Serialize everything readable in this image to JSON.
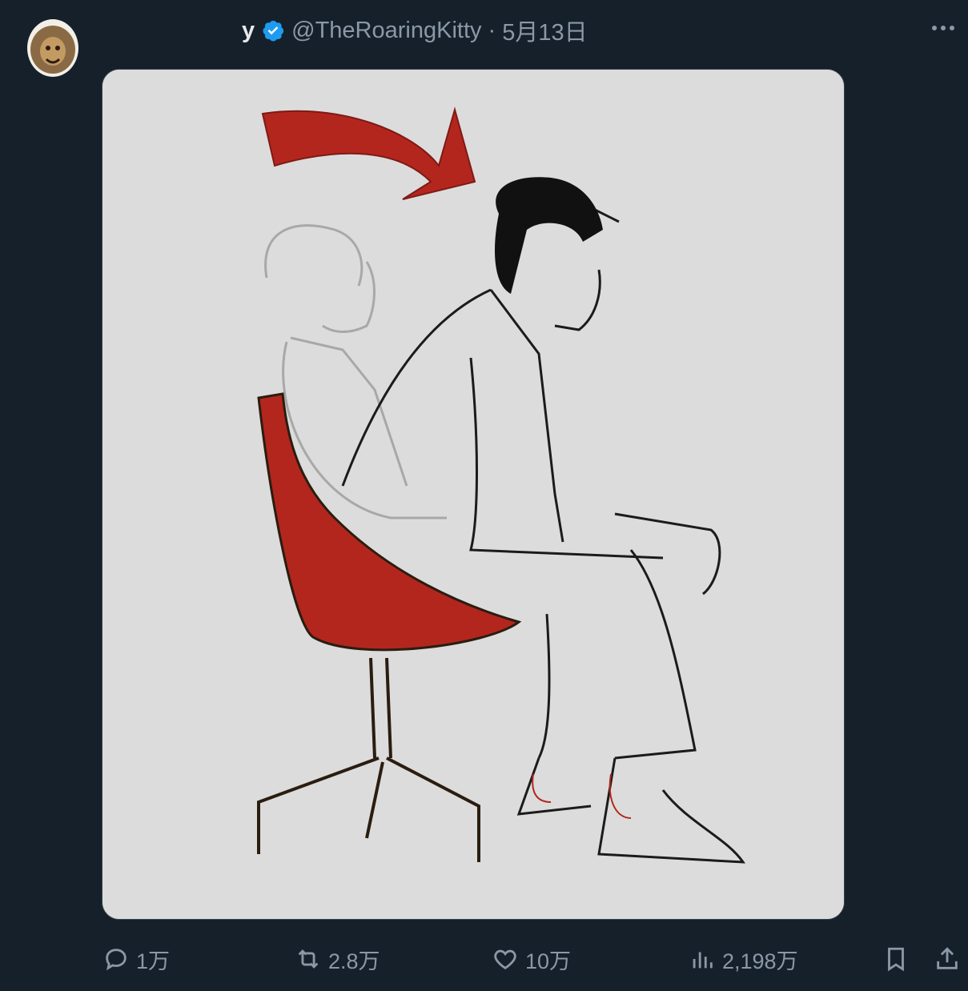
{
  "tweet": {
    "display_name": "y",
    "handle": "@TheRoaringKitty",
    "separator": "·",
    "date": "5月13日",
    "media_alt": "illustration"
  },
  "icons": {
    "avatar": "avatar-lion",
    "verified": "verified-badge-icon",
    "more": "more-dots-icon",
    "reply": "reply-icon",
    "retweet": "retweet-icon",
    "like": "heart-icon",
    "views": "views-bar-chart-icon",
    "bookmark": "bookmark-icon",
    "share": "share-icon"
  },
  "actions": {
    "replies": "1万",
    "retweets": "2.8万",
    "likes": "10万",
    "views": "2,198万"
  },
  "colors": {
    "background": "#15202b",
    "verified_blue": "#1d9bf0",
    "muted_text": "#8b98a5",
    "chair_red": "#b3261e"
  }
}
